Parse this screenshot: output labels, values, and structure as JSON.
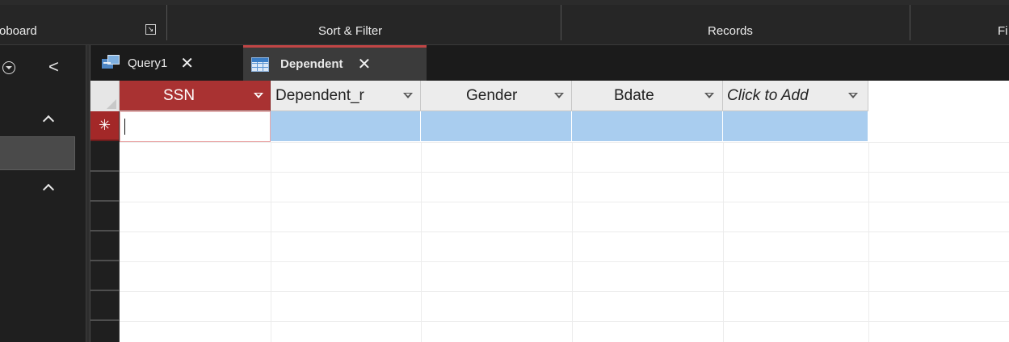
{
  "ribbon": {
    "groups": [
      {
        "label": "oboard"
      },
      {
        "label": "Sort & Filter"
      },
      {
        "label": "Records"
      },
      {
        "label": "Fi"
      }
    ],
    "launcher_icon": "dialog-launcher-icon"
  },
  "nav": {
    "menu_icon": "chevron-down-circle-icon",
    "collapse_icon": "chevron-left-icon",
    "collapse_glyph": "<",
    "section_icon": "chevron-up-icon"
  },
  "tabs": [
    {
      "label": "Query1",
      "icon": "query-icon",
      "close": "✕",
      "active": false
    },
    {
      "label": "Dependent",
      "icon": "table-icon",
      "close": "✕",
      "active": true
    }
  ],
  "datasheet": {
    "columns": [
      {
        "label": "SSN",
        "active": true
      },
      {
        "label": "Dependent_r",
        "active": false
      },
      {
        "label": "Gender",
        "active": false
      },
      {
        "label": "Bdate",
        "active": false
      },
      {
        "label": "Click to Add",
        "active": false
      }
    ],
    "new_record_marker": "✳",
    "new_row_values": [
      "",
      "",
      "",
      "",
      ""
    ]
  },
  "colors": {
    "accent": "#a93232",
    "selection": "#a9cdef",
    "ribbon_bg": "#262626"
  }
}
